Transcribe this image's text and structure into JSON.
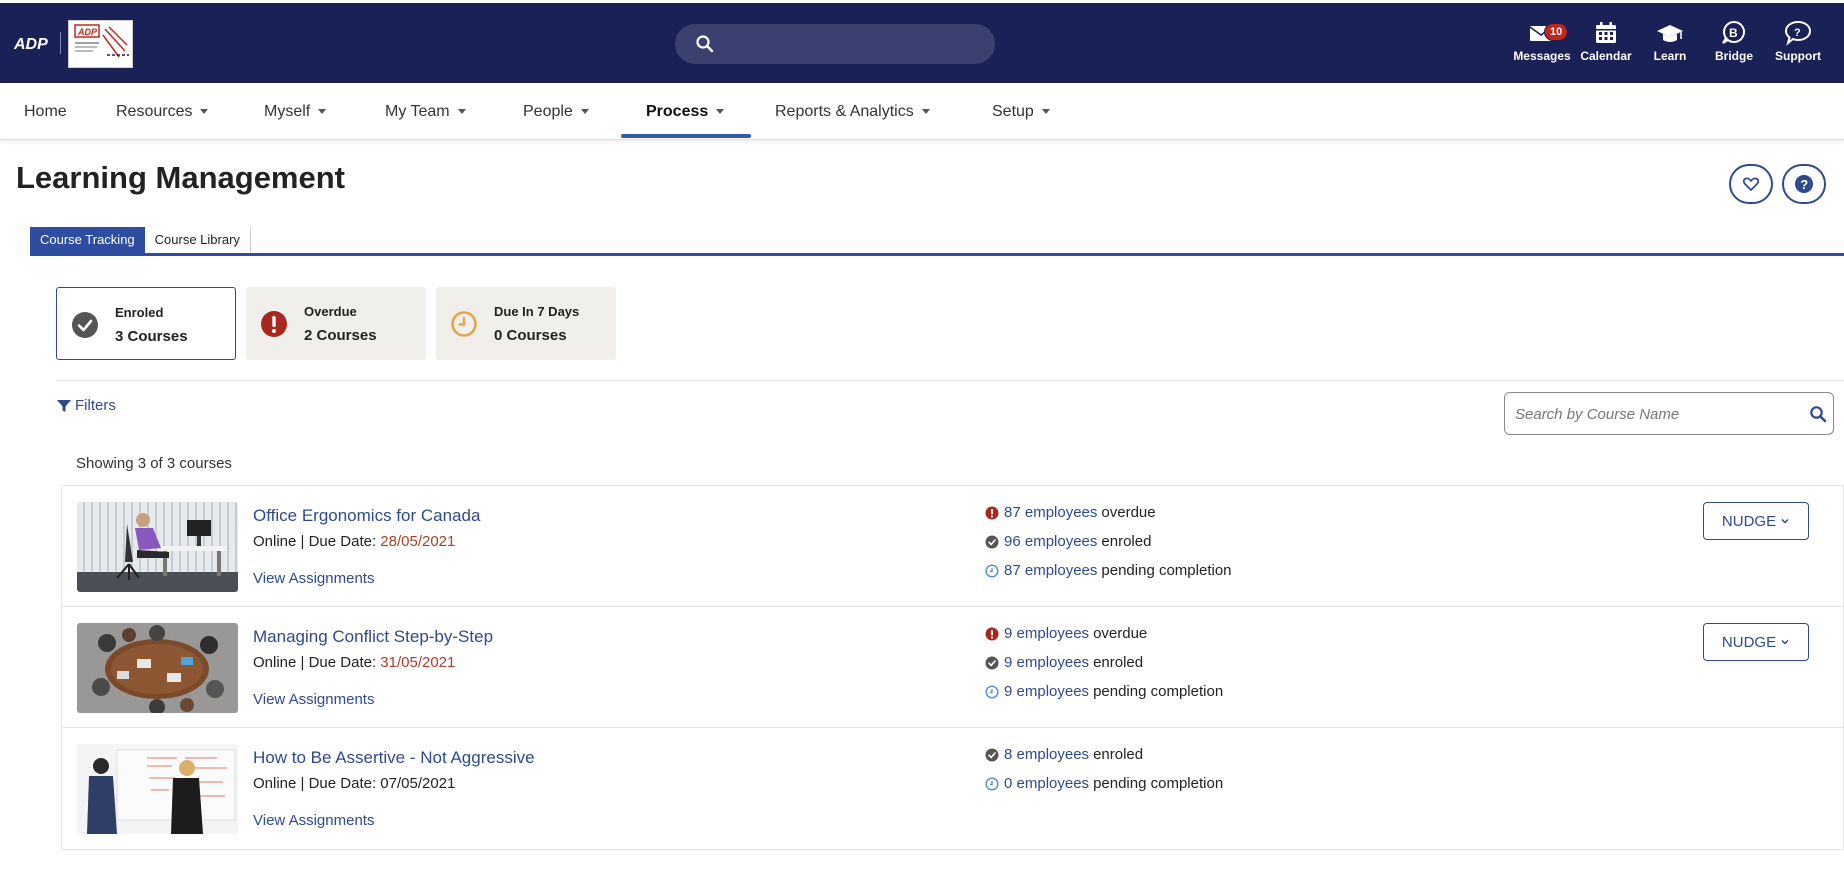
{
  "topbar": {
    "search_placeholder": "",
    "icons": [
      {
        "label": "Messages",
        "icon": "envelope-icon",
        "badge": "10"
      },
      {
        "label": "Calendar",
        "icon": "calendar-icon"
      },
      {
        "label": "Learn",
        "icon": "graduation-cap-icon"
      },
      {
        "label": "Bridge",
        "icon": "bridge-icon"
      },
      {
        "label": "Support",
        "icon": "chat-question-icon"
      }
    ],
    "colors": {
      "bar": "#1a2156",
      "badge": "#c0281e"
    }
  },
  "nav": {
    "items": [
      "Home",
      "Resources",
      "Myself",
      "My Team",
      "People",
      "Process",
      "Reports & Analytics",
      "Setup"
    ],
    "active": "Process"
  },
  "page": {
    "title": "Learning Management"
  },
  "tabs": {
    "active": "Course Tracking",
    "inactive": "Course Library"
  },
  "summary": [
    {
      "title": "Enroled",
      "value": "3 Courses",
      "icon": "check-circle-icon"
    },
    {
      "title": "Overdue",
      "value": "2 Courses",
      "icon": "alert-circle-icon"
    },
    {
      "title": "Due In 7 Days",
      "value": "0 Courses",
      "icon": "clock-icon"
    }
  ],
  "filters": {
    "label": "Filters",
    "search_placeholder": "Search by Course Name"
  },
  "showing": "Showing 3 of 3 courses",
  "courses": [
    {
      "name": "Office Ergonomics for Canada",
      "meta_prefix": "Online | Due Date: ",
      "due": "28/05/2021",
      "view": "View Assignments",
      "overdue_link": "87 employees",
      "overdue_text": "overdue",
      "enroled_link": "96 employees",
      "enroled_text": "enroled",
      "pending_link": "87 employees",
      "pending_text": "pending completion",
      "nudge": "NUDGE"
    },
    {
      "name": "Managing Conflict Step-by-Step",
      "meta_prefix": "Online | Due Date: ",
      "due": "31/05/2021",
      "view": "View Assignments",
      "overdue_link": "9 employees",
      "overdue_text": "overdue",
      "enroled_link": "9 employees",
      "enroled_text": "enroled",
      "pending_link": "9 employees",
      "pending_text": "pending completion",
      "nudge": "NUDGE"
    },
    {
      "name": "How to Be Assertive - Not Aggressive",
      "meta_prefix": "Online | Due Date: ",
      "due": "07/05/2021",
      "view": "View Assignments",
      "enroled_link": "8 employees",
      "enroled_text": "enroled",
      "pending_link": "0 employees",
      "pending_text": "pending completion"
    }
  ],
  "colors": {
    "accent": "#2e4a8c",
    "tab": "#2e4da0",
    "overdue": "#a8281e",
    "due_date": "#a8402a",
    "pending": "#5b8fd6"
  }
}
